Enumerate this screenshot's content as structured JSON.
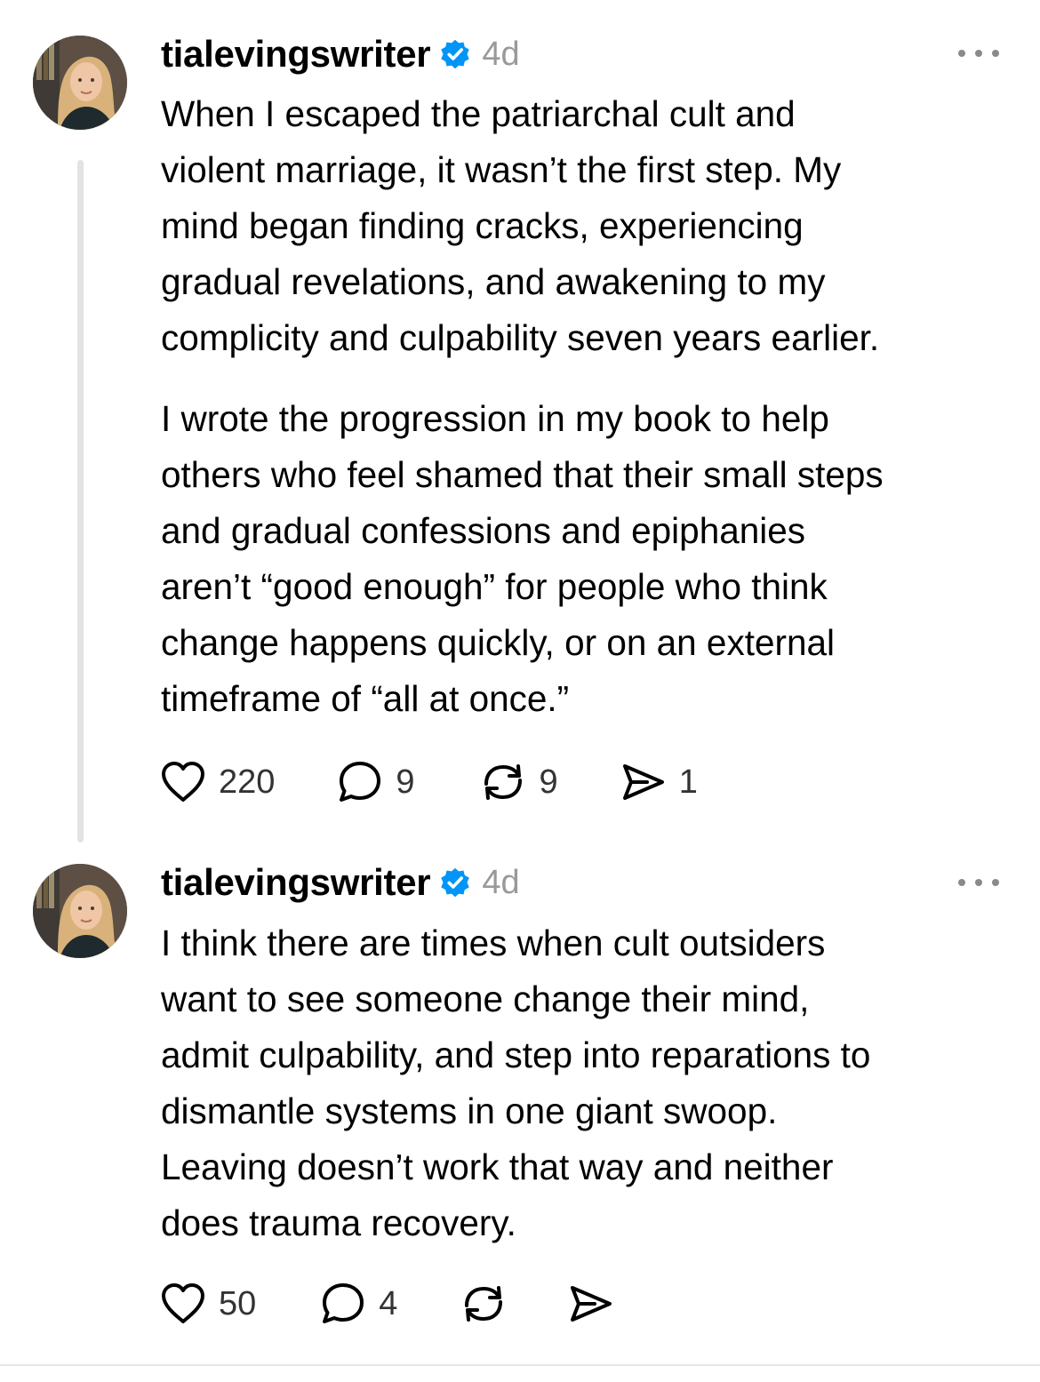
{
  "posts": [
    {
      "username": "tialevingswriter",
      "timestamp": "4d",
      "paragraphs": [
        [
          "When I escaped the patriarchal cult and",
          "violent marriage, it wasn’t the first step. My",
          "mind began finding cracks, experiencing",
          "gradual revelations, and awakening to my",
          "complicity and culpability seven years earlier."
        ],
        [
          "I wrote the progression in my book to help",
          "others who feel shamed that their small steps",
          "and gradual confessions and epiphanies",
          "aren’t “good enough” for people who think",
          "change happens quickly, or on an external",
          "timeframe of “all at once.”"
        ]
      ],
      "likes": "220",
      "replies": "9",
      "reposts": "9",
      "shares": "1"
    },
    {
      "username": "tialevingswriter",
      "timestamp": "4d",
      "paragraphs": [
        [
          "I think there are times when cult outsiders",
          "want to see someone change their mind,",
          "admit culpability, and step into reparations to",
          "dismantle systems in one giant swoop.",
          "Leaving doesn’t work that way and neither",
          "does trauma recovery."
        ]
      ],
      "likes": "50",
      "replies": "4",
      "reposts": "",
      "shares": ""
    }
  ],
  "icons": {
    "verified_color": "#0095f6",
    "avatar": "avatar-photo",
    "more": "more-options-icon",
    "like": "heart-icon",
    "reply": "comment-icon",
    "repost": "repost-icon",
    "share": "share-icon"
  }
}
